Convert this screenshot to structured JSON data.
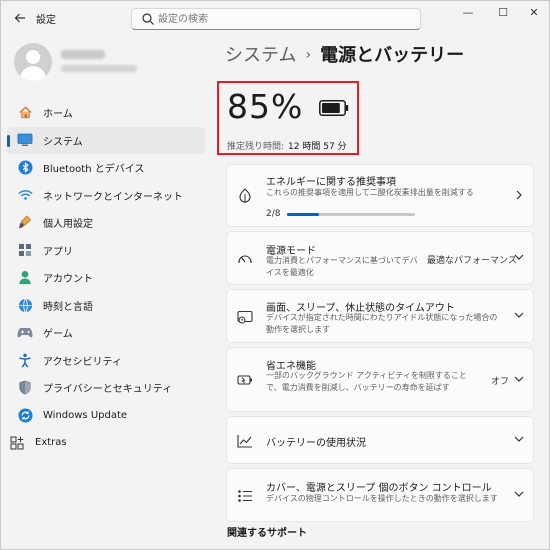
{
  "window": {
    "app_title": "設定",
    "search_placeholder": "設定の検索",
    "minimize": "—",
    "maximize": "☐",
    "close": "✕"
  },
  "sidebar": {
    "items": [
      {
        "label": "ホーム",
        "icon": "home-icon",
        "active": false
      },
      {
        "label": "システム",
        "icon": "system-icon",
        "active": true
      },
      {
        "label": "Bluetooth とデバイス",
        "icon": "bluetooth-icon",
        "active": false
      },
      {
        "label": "ネットワークとインターネット",
        "icon": "network-icon",
        "active": false
      },
      {
        "label": "個人用設定",
        "icon": "personalization-icon",
        "active": false
      },
      {
        "label": "アプリ",
        "icon": "apps-icon",
        "active": false
      },
      {
        "label": "アカウント",
        "icon": "account-icon",
        "active": false
      },
      {
        "label": "時刻と言語",
        "icon": "time-language-icon",
        "active": false
      },
      {
        "label": "ゲーム",
        "icon": "gaming-icon",
        "active": false
      },
      {
        "label": "アクセシビリティ",
        "icon": "accessibility-icon",
        "active": false
      },
      {
        "label": "プライバシーとセキュリティ",
        "icon": "privacy-shield-icon",
        "active": false
      },
      {
        "label": "Windows Update",
        "icon": "windows-update-icon",
        "active": false
      },
      {
        "label": "Extras",
        "icon": "extras-icon",
        "active": false
      }
    ]
  },
  "breadcrumb": {
    "parent": "システム",
    "separator": "›",
    "current": "電源とバッテリー"
  },
  "battery": {
    "percent": "85%",
    "level": 0.85,
    "remaining_label": "推定残り時間:",
    "remaining_value": "12 時間 57 分"
  },
  "cards": {
    "energy": {
      "title": "エネルギーに関する推奨事項",
      "desc": "これらの推奨事項を適用して二酸化炭素排出量を削減する",
      "progress_text": "2/8",
      "progress": 0.25
    },
    "power_mode": {
      "title": "電源モード",
      "desc": "電力消費とパフォーマンスに基づいてデバイスを最適化",
      "value": "最適なパフォーマンス"
    },
    "screen_sleep": {
      "title": "画面、スリープ、休止状態のタイムアウト",
      "desc": "デバイスが指定された時間にわたりアイドル状態になった場合の動作を選択します"
    },
    "energy_saver": {
      "title": "省エネ機能",
      "desc": "一部のバックグラウンド アクティビティを制限することで、電力消費を削減し、バッテリーの寿命を延ばす",
      "value": "オフ"
    },
    "battery_usage": {
      "title": "バッテリーの使用状況"
    },
    "lid_buttons": {
      "title": "カバー、電源とスリープ 個のボタン コントロール",
      "desc": "デバイスの物理コントロールを操作したときの動作を選択します"
    }
  },
  "related": {
    "heading": "関連するサポート"
  },
  "colors": {
    "accent": "#0067c0",
    "highlight_border": "#e02020"
  }
}
